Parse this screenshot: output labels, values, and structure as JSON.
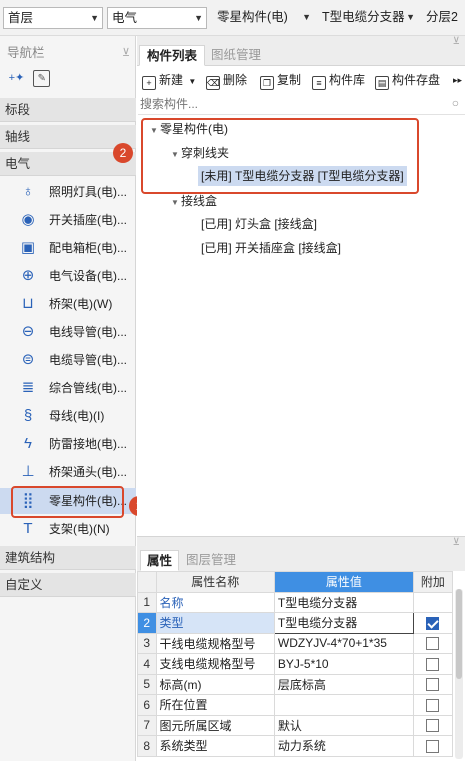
{
  "topbar": {
    "floor": "首层",
    "discipline": "电气",
    "category": "零星构件(电)",
    "component": "T型电缆分支器",
    "layer": "分层2"
  },
  "nav": {
    "title": "导航栏",
    "categories": {
      "biaoduan": "标段",
      "zhouxian": "轴线",
      "dianqi": "电气",
      "jianzhu": "建筑结构",
      "zidingyi": "自定义"
    },
    "items": [
      {
        "label": "照明灯具(电)...",
        "icon": "lightbulb-icon"
      },
      {
        "label": "开关插座(电)...",
        "icon": "switch-icon"
      },
      {
        "label": "配电箱柜(电)...",
        "icon": "distribution-box-icon"
      },
      {
        "label": "电气设备(电)...",
        "icon": "electrical-device-icon"
      },
      {
        "label": "桥架(电)(W)",
        "icon": "tray-icon"
      },
      {
        "label": "电线导管(电)...",
        "icon": "wire-conduit-icon"
      },
      {
        "label": "电缆导管(电)...",
        "icon": "cable-conduit-icon"
      },
      {
        "label": "综合管线(电)...",
        "icon": "combined-pipeline-icon"
      },
      {
        "label": "母线(电)(I)",
        "icon": "busbar-icon"
      },
      {
        "label": "防雷接地(电)...",
        "icon": "lightning-ground-icon"
      },
      {
        "label": "桥架通头(电)...",
        "icon": "tray-joint-icon"
      },
      {
        "label": "零星构件(电)...",
        "icon": "misc-component-icon"
      },
      {
        "label": "支架(电)(N)",
        "icon": "bracket-icon"
      }
    ]
  },
  "component_panel": {
    "tab_list": "构件列表",
    "tab_drawings": "图纸管理",
    "toolbar": {
      "new": "新建",
      "delete": "删除",
      "copy": "复制",
      "library": "构件库",
      "save": "构件存盘"
    },
    "search_placeholder": "搜索构件...",
    "tree": {
      "root": "零星构件(电)",
      "group1": "穿刺线夹",
      "group1_item": "[未用] T型电缆分支器 [T型电缆分支器]",
      "group2": "接线盒",
      "group2_item1": "[已用] 灯头盒 [接线盒]",
      "group2_item2": "[已用] 开关插座盒 [接线盒]"
    }
  },
  "props_panel": {
    "tab_props": "属性",
    "tab_layers": "图层管理",
    "header": {
      "name": "属性名称",
      "value": "属性值",
      "extra": "附加"
    },
    "rows": [
      {
        "num": "1",
        "name": "名称",
        "value": "T型电缆分支器",
        "blue": true,
        "check": null
      },
      {
        "num": "2",
        "name": "类型",
        "value": "T型电缆分支器",
        "blue": true,
        "check": true
      },
      {
        "num": "3",
        "name": "干线电缆规格型号",
        "value": "WDZYJV-4*70+1*35",
        "blue": false,
        "check": false
      },
      {
        "num": "4",
        "name": "支线电缆规格型号",
        "value": "BYJ-5*10",
        "blue": false,
        "check": false
      },
      {
        "num": "5",
        "name": "标高(m)",
        "value": "层底标高",
        "blue": false,
        "check": false
      },
      {
        "num": "6",
        "name": "所在位置",
        "value": "",
        "blue": false,
        "check": false
      },
      {
        "num": "7",
        "name": "图元所属区域",
        "value": "默认",
        "blue": false,
        "check": false
      },
      {
        "num": "8",
        "name": "系统类型",
        "value": "动力系统",
        "blue": false,
        "check": false
      }
    ]
  },
  "annotations": {
    "badge1": "1",
    "badge2": "2"
  },
  "colors": {
    "accent": "#2a62b8",
    "highlight": "#d9482c",
    "header_blue": "#3f8fe3",
    "selection": "#ccdaf0"
  }
}
